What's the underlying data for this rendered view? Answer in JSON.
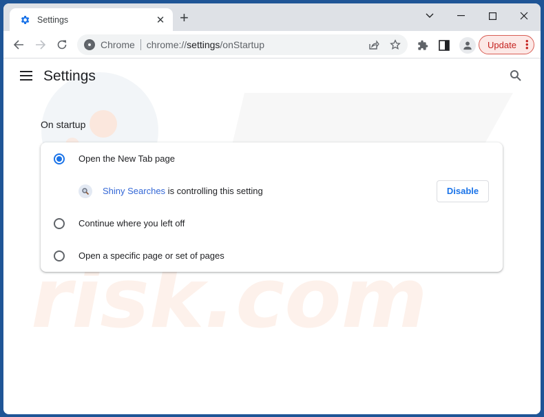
{
  "browser": {
    "tab": {
      "title": "Settings",
      "favicon": "gear-icon"
    },
    "window_controls": [
      "tab-search",
      "minimize",
      "maximize",
      "close"
    ],
    "omnibox": {
      "site_label": "Chrome",
      "url_prefix": "chrome://",
      "url_host": "settings",
      "url_path": "/onStartup"
    },
    "update_label": "Update"
  },
  "settings": {
    "title": "Settings",
    "section_title": "On startup",
    "options": [
      {
        "label": "Open the New Tab page",
        "selected": true
      },
      {
        "label": "Continue where you left off",
        "selected": false
      },
      {
        "label": "Open a specific page or set of pages",
        "selected": false
      }
    ],
    "extension_notice": {
      "extension_name": "Shiny Searches",
      "text": " is controlling this setting",
      "button_label": "Disable"
    }
  },
  "colors": {
    "accent": "#1a73e8",
    "link": "#3367d6",
    "update_text": "#c5221f",
    "frame": "#1f5596"
  }
}
